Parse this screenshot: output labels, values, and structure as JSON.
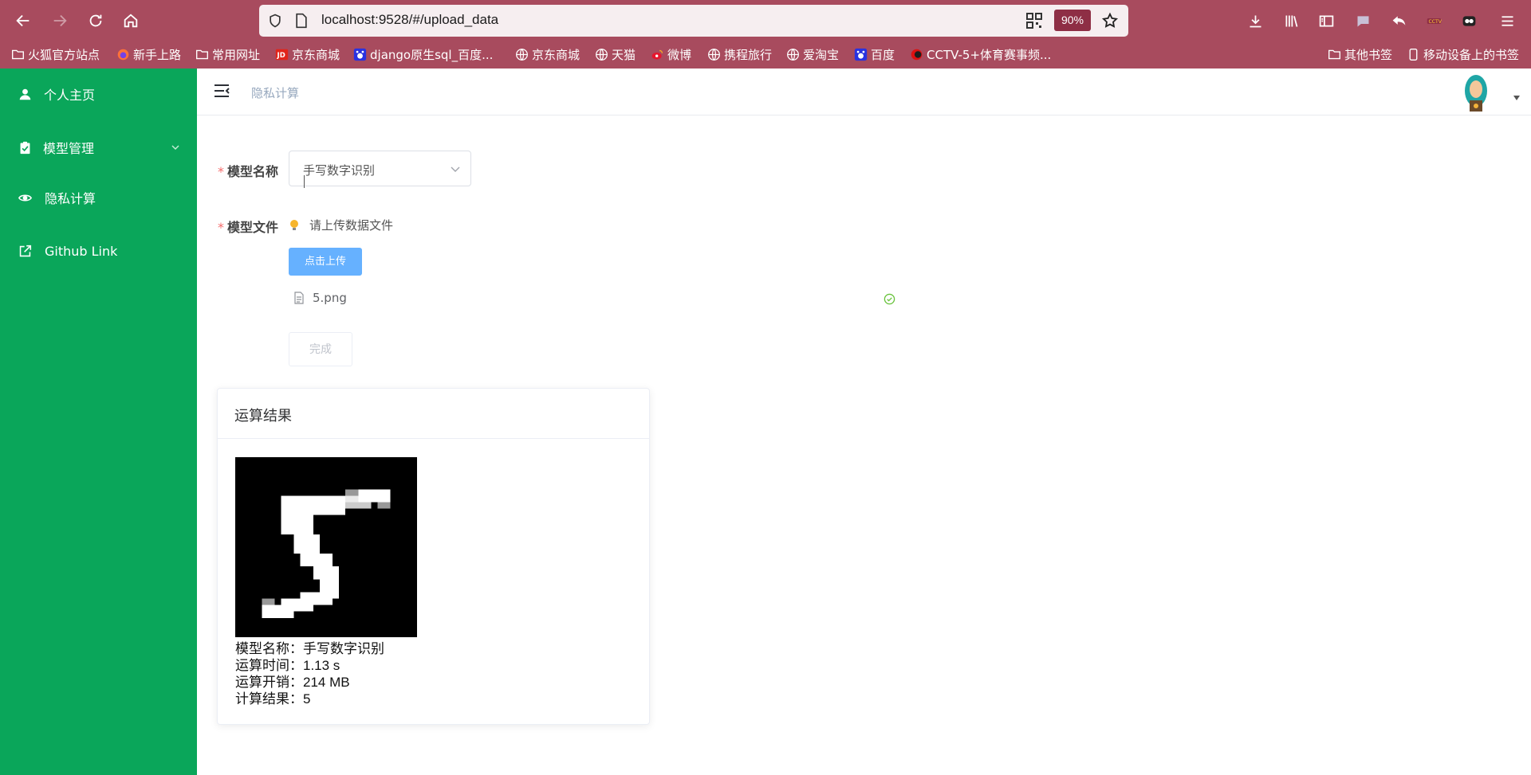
{
  "browser": {
    "url": "localhost:9528/#/upload_data",
    "zoom": "90%"
  },
  "bookmarks": [
    {
      "label": "火狐官方站点",
      "icon": "folder-icon"
    },
    {
      "label": "新手上路",
      "icon": "firefox-icon"
    },
    {
      "label": "常用网址",
      "icon": "folder-icon"
    },
    {
      "label": "京东商城",
      "icon": "jd-icon"
    },
    {
      "label": "django原生sql_百度...",
      "icon": "baidu-icon"
    },
    {
      "label": "京东商城",
      "icon": "globe-icon"
    },
    {
      "label": "天猫",
      "icon": "globe-icon"
    },
    {
      "label": "微博",
      "icon": "weibo-icon"
    },
    {
      "label": "携程旅行",
      "icon": "globe-icon"
    },
    {
      "label": "爱淘宝",
      "icon": "globe-icon"
    },
    {
      "label": "百度",
      "icon": "baidu-icon"
    },
    {
      "label": "CCTV-5+体育赛事频...",
      "icon": "cctv-icon"
    },
    {
      "label": "其他书签",
      "icon": "folder-icon"
    },
    {
      "label": "移动设备上的书签",
      "icon": "mobile-icon"
    }
  ],
  "sidebar": {
    "items": [
      {
        "label": "个人主页",
        "icon": "user-icon"
      },
      {
        "label": "模型管理",
        "icon": "clipboard-check-icon"
      },
      {
        "label": "隐私计算",
        "icon": "eye-icon"
      },
      {
        "label": "Github Link",
        "icon": "external-link-icon"
      }
    ]
  },
  "header": {
    "breadcrumb": "隐私计算"
  },
  "form": {
    "model_name_label": "模型名称",
    "model_name_value": "手写数字识别",
    "model_file_label": "模型文件",
    "tip": "请上传数据文件",
    "upload_button": "点击上传",
    "file_name": "5.png",
    "done_button": "完成",
    "required_mark": "*"
  },
  "result": {
    "title": "运算结果",
    "lines": [
      "模型名称：手写数字识别",
      "运算时间：1.13 s",
      "运算开销：214 MB",
      "计算结果：5"
    ]
  },
  "colors": {
    "chrome": "#a84b5e",
    "sidebar": "#0aa65a",
    "primary_light": "#66b1ff",
    "required": "#f56c6c",
    "success": "#67c23a"
  }
}
